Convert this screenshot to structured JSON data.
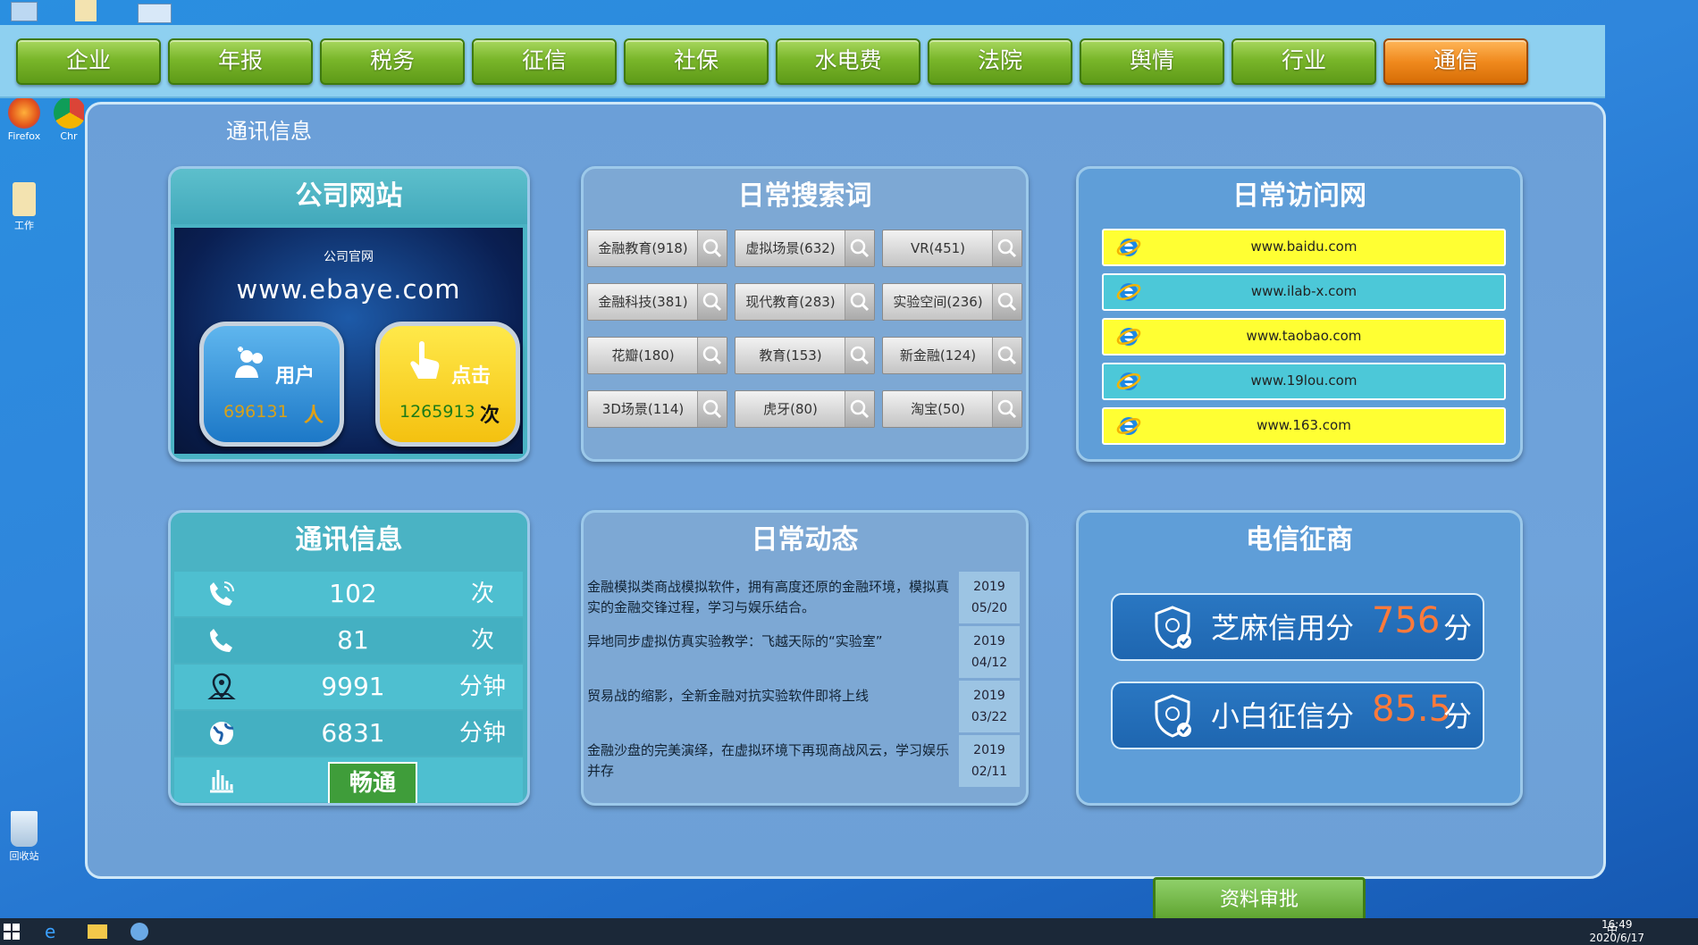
{
  "desktop_icons": [
    {
      "label": "Firefox",
      "icon": "firefox-icon"
    },
    {
      "label": "Chr",
      "icon": "chrome-icon"
    },
    {
      "label": "工作",
      "icon": "folder-icon"
    },
    {
      "label": "回收站",
      "icon": "recycle-bin-icon"
    }
  ],
  "nav": {
    "tabs": [
      "企业",
      "年报",
      "税务",
      "征信",
      "社保",
      "水电费",
      "法院",
      "舆情",
      "行业",
      "通信"
    ],
    "active_index": 9
  },
  "main": {
    "title": "通讯信息"
  },
  "company_site": {
    "title": "公司网站",
    "subtitle": "公司官网",
    "url": "www.ebaye.com",
    "users": {
      "label": "用户",
      "value": "696131",
      "unit": "人"
    },
    "clicks": {
      "label": "点击",
      "value": "1265913",
      "unit": "次"
    }
  },
  "search_words": {
    "title": "日常搜索词",
    "items": [
      "金融教育(918)",
      "虚拟场景(632)",
      "VR(451)",
      "金融科技(381)",
      "现代教育(283)",
      "实验空间(236)",
      "花瓣(180)",
      "教育(153)",
      "新金融(124)",
      "3D场景(114)",
      "虎牙(80)",
      "淘宝(50)"
    ]
  },
  "visited_sites": {
    "title": "日常访问网",
    "items": [
      {
        "url": "www.baidu.com",
        "color": "#ffff33"
      },
      {
        "url": "www.ilab-x.com",
        "color": "#4cc8d8"
      },
      {
        "url": "www.taobao.com",
        "color": "#ffff33"
      },
      {
        "url": "www.19lou.com",
        "color": "#4cc8d8"
      },
      {
        "url": "www.163.com",
        "color": "#ffff33"
      }
    ]
  },
  "comm_info": {
    "title": "通讯信息",
    "rows": [
      {
        "icon": "phone-call-icon",
        "value": "102",
        "unit": "次"
      },
      {
        "icon": "phone-icon",
        "value": "81",
        "unit": "次"
      },
      {
        "icon": "map-pin-icon",
        "value": "9991",
        "unit": "分钟"
      },
      {
        "icon": "globe-icon",
        "value": "6831",
        "unit": "分钟"
      }
    ],
    "status_icon": "signal-bars-icon",
    "status": "畅通"
  },
  "daily_news": {
    "title": "日常动态",
    "items": [
      {
        "text": "金融模拟类商战模拟软件，拥有高度还原的金融环境，模拟真实的金融交锋过程，学习与娱乐结合。",
        "year": "2019",
        "date": "05/20"
      },
      {
        "text": "异地同步虚拟仿真实验教学：飞越天际的“实验室”",
        "year": "2019",
        "date": "04/12"
      },
      {
        "text": "贸易战的缩影，全新金融对抗实验软件即将上线",
        "year": "2019",
        "date": "03/22"
      },
      {
        "text": "金融沙盘的完美演绎，在虚拟环境下再现商战风云，学习娱乐并存",
        "year": "2019",
        "date": "02/11"
      }
    ]
  },
  "telecom_credit": {
    "title": "电信征商",
    "items": [
      {
        "label": "芝麻信用分",
        "score": "756",
        "unit": "分"
      },
      {
        "label": "小白征信分",
        "score": "85.5",
        "unit": "分"
      }
    ]
  },
  "approve_button": "资料审批",
  "taskbar": {
    "ime": "中",
    "time": "16:49",
    "date": "2020/6/17"
  },
  "colors": {
    "tab_green": "#79b62a",
    "tab_orange": "#f08a1e",
    "score_orange": "#ff7a3a",
    "status_green": "#3f9d3a"
  }
}
